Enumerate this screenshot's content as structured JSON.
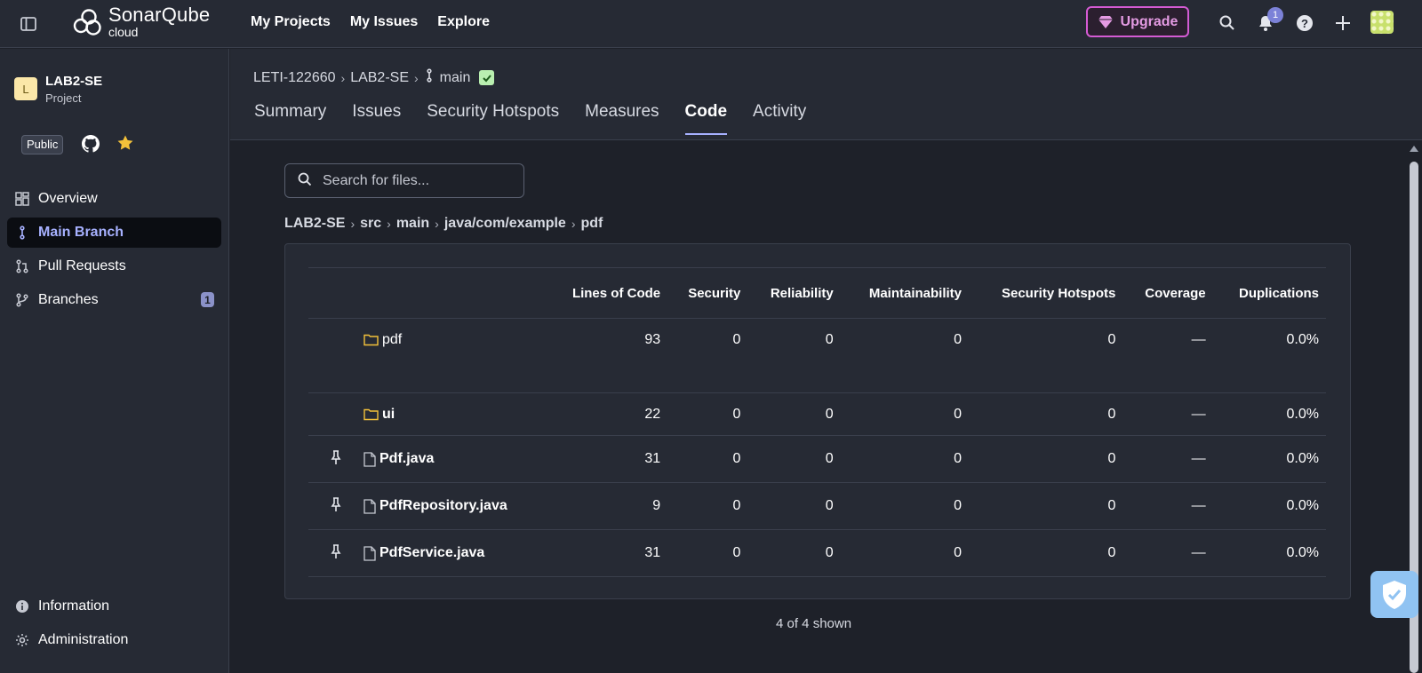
{
  "topbar": {
    "logo_main": "SonarQube",
    "logo_sub": "cloud",
    "nav": [
      "My Projects",
      "My Issues",
      "Explore"
    ],
    "upgrade_label": "Upgrade",
    "notification_count": "1"
  },
  "sidebar": {
    "project_initial": "L",
    "project_name": "LAB2-SE",
    "project_type": "Project",
    "visibility": "Public",
    "items": [
      {
        "label": "Overview",
        "icon": "overview-icon"
      },
      {
        "label": "Main Branch",
        "icon": "branch-icon",
        "active": true
      },
      {
        "label": "Pull Requests",
        "icon": "pull-request-icon"
      },
      {
        "label": "Branches",
        "icon": "branches-icon",
        "count": "1"
      }
    ],
    "footer_items": [
      {
        "label": "Information",
        "icon": "info-icon"
      },
      {
        "label": "Administration",
        "icon": "gear-icon"
      }
    ]
  },
  "header": {
    "breadcrumb": [
      "LETI-122660",
      "LAB2-SE",
      "main"
    ],
    "tabs": [
      "Summary",
      "Issues",
      "Security Hotspots",
      "Measures",
      "Code",
      "Activity"
    ],
    "active_tab": "Code"
  },
  "code": {
    "search_placeholder": "Search for files...",
    "path": [
      "LAB2-SE",
      "src",
      "main",
      "java/com/example",
      "pdf"
    ],
    "columns": [
      "Lines of Code",
      "Security",
      "Reliability",
      "Maintainability",
      "Security Hotspots",
      "Coverage",
      "Duplications"
    ],
    "rows": [
      {
        "type": "folder",
        "name": "pdf",
        "loc": "93",
        "security": "0",
        "reliability": "0",
        "maintainability": "0",
        "hotspots": "0",
        "coverage": "—",
        "duplications": "0.0%"
      },
      {
        "type": "folder",
        "name": "ui",
        "loc": "22",
        "security": "0",
        "reliability": "0",
        "maintainability": "0",
        "hotspots": "0",
        "coverage": "—",
        "duplications": "0.0%"
      },
      {
        "type": "file",
        "name": "Pdf.java",
        "loc": "31",
        "security": "0",
        "reliability": "0",
        "maintainability": "0",
        "hotspots": "0",
        "coverage": "—",
        "duplications": "0.0%"
      },
      {
        "type": "file",
        "name": "PdfRepository.java",
        "loc": "9",
        "security": "0",
        "reliability": "0",
        "maintainability": "0",
        "hotspots": "0",
        "coverage": "—",
        "duplications": "0.0%"
      },
      {
        "type": "file",
        "name": "PdfService.java",
        "loc": "31",
        "security": "0",
        "reliability": "0",
        "maintainability": "0",
        "hotspots": "0",
        "coverage": "—",
        "duplications": "0.0%"
      }
    ],
    "shown_text": "4 of 4 shown"
  },
  "colors": {
    "background": "#1e2129",
    "panel": "#262a34",
    "accent": "#a7b1ff",
    "upgrade": "#d45bd3"
  }
}
